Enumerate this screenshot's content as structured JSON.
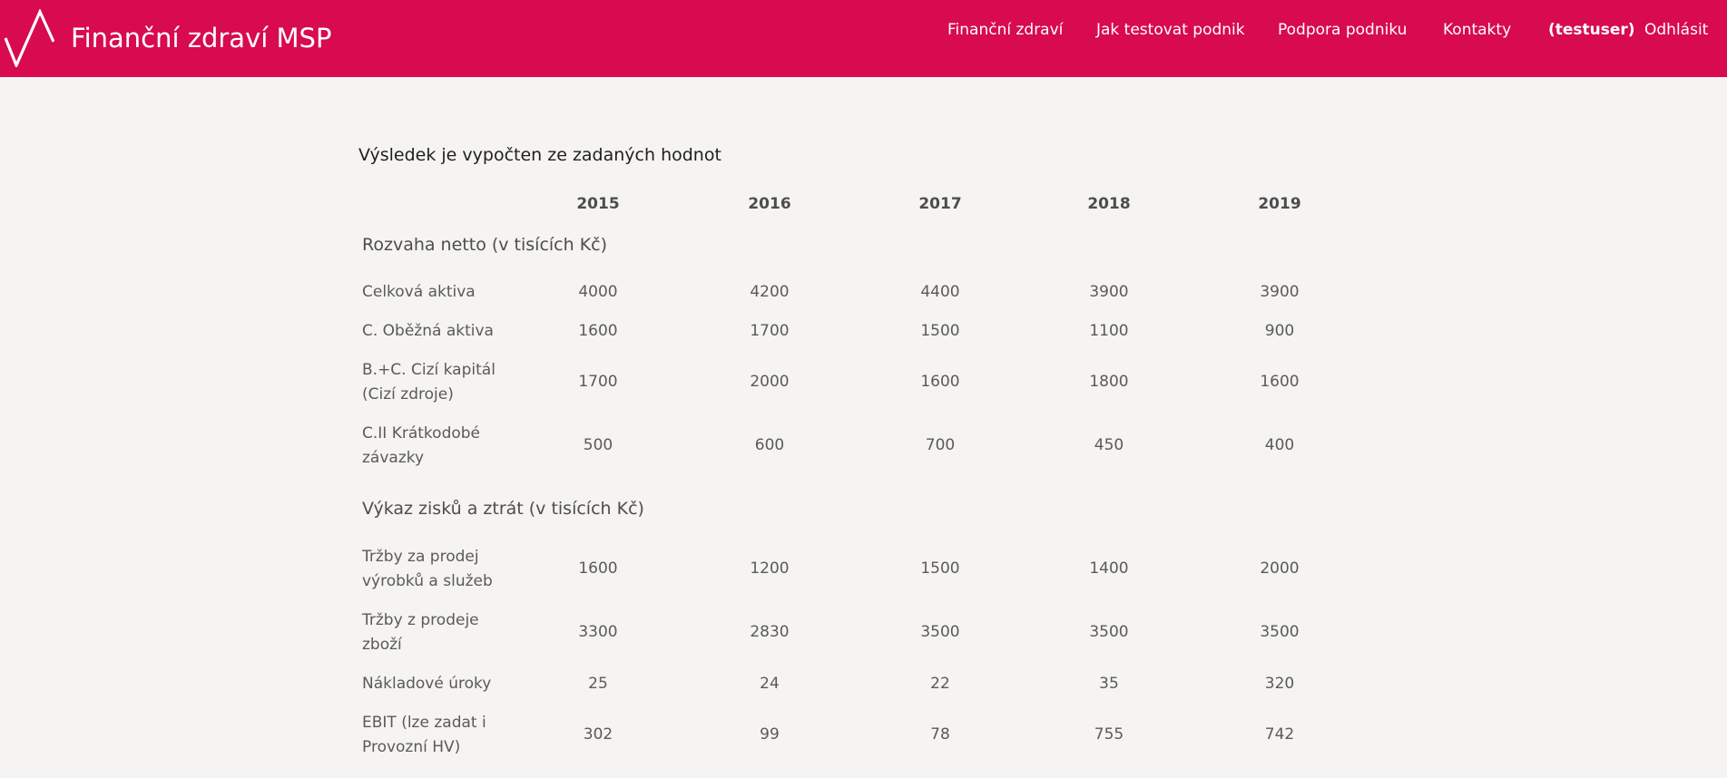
{
  "header": {
    "brand": "Finanční zdraví MSP",
    "nav": [
      "Finanční zdraví",
      "Jak testovat podnik",
      "Podpora podniku",
      "Kontakty"
    ],
    "user": "(testuser)",
    "logout": "Odhlásit"
  },
  "main": {
    "result_title": "Výsledek je vypočten ze zadaných hodnot",
    "years": [
      "2015",
      "2016",
      "2017",
      "2018",
      "2019"
    ],
    "sections": [
      {
        "title": "Rozvaha netto (v tisících Kč)",
        "rows": [
          {
            "label": "Celková aktiva",
            "values": [
              "4000",
              "4200",
              "4400",
              "3900",
              "3900"
            ]
          },
          {
            "label": "C. Oběžná aktiva",
            "values": [
              "1600",
              "1700",
              "1500",
              "1100",
              "900"
            ]
          },
          {
            "label": "B.+C. Cizí kapitál (Cizí zdroje)",
            "values": [
              "1700",
              "2000",
              "1600",
              "1800",
              "1600"
            ]
          },
          {
            "label": "C.II Krátkodobé závazky",
            "values": [
              "500",
              "600",
              "700",
              "450",
              "400"
            ]
          }
        ]
      },
      {
        "title": "Výkaz zisků a ztrát (v tisících Kč)",
        "rows": [
          {
            "label": "Tržby za prodej výrobků a služeb",
            "values": [
              "1600",
              "1200",
              "1500",
              "1400",
              "2000"
            ]
          },
          {
            "label": "Tržby z prodeje zboží",
            "values": [
              "3300",
              "2830",
              "3500",
              "3500",
              "3500"
            ]
          },
          {
            "label": "Nákladové úroky",
            "values": [
              "25",
              "24",
              "22",
              "35",
              "320"
            ]
          },
          {
            "label": "EBIT (lze zadat i Provozní HV)",
            "values": [
              "302",
              "99",
              "78",
              "755",
              "742"
            ]
          }
        ]
      }
    ]
  },
  "colors": {
    "header_bg": "#d80a50",
    "page_bg": "#f5f4f2",
    "text": "#5a5a5a"
  }
}
